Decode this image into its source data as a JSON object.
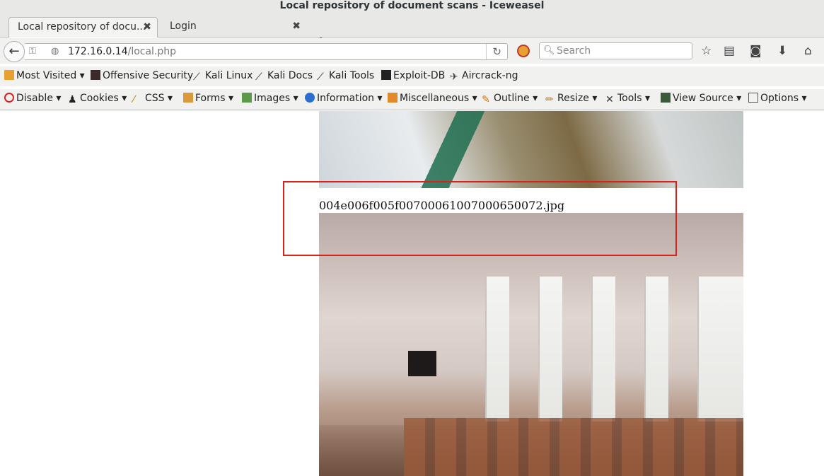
{
  "window": {
    "title": "Local repository of document scans - Iceweasel"
  },
  "tabs": [
    {
      "label": "Local repository of docu...",
      "close": "✖"
    },
    {
      "label": "Login",
      "close": "✖"
    }
  ],
  "newtab": "✚",
  "nav": {
    "url_host": "172.16.0.14",
    "url_path": "/local.php",
    "search_placeholder": "Search"
  },
  "bookmarks": [
    {
      "label": "Most Visited",
      "arrow": "▾"
    },
    {
      "label": "Offensive Security"
    },
    {
      "label": "Kali Linux"
    },
    {
      "label": "Kali Docs"
    },
    {
      "label": "Kali Tools"
    },
    {
      "label": "Exploit-DB"
    },
    {
      "label": "Aircrack-ng"
    }
  ],
  "webdev": [
    {
      "label": "Disable",
      "arrow": "▾"
    },
    {
      "label": "Cookies",
      "arrow": "▾"
    },
    {
      "label": "CSS",
      "arrow": "▾"
    },
    {
      "label": "Forms",
      "arrow": "▾"
    },
    {
      "label": "Images",
      "arrow": "▾"
    },
    {
      "label": "Information",
      "arrow": "▾"
    },
    {
      "label": "Miscellaneous",
      "arrow": "▾"
    },
    {
      "label": "Outline",
      "arrow": "▾"
    },
    {
      "label": "Resize",
      "arrow": "▾"
    },
    {
      "label": "Tools",
      "arrow": "▾"
    },
    {
      "label": "View Source",
      "arrow": "▾"
    },
    {
      "label": "Options",
      "arrow": "▾"
    }
  ],
  "content": {
    "filename": "004e006f005f00700061007000650072.jpg"
  },
  "colors": {
    "highlight": "#d9221e",
    "chrome_bg": "#f1f1f0"
  }
}
